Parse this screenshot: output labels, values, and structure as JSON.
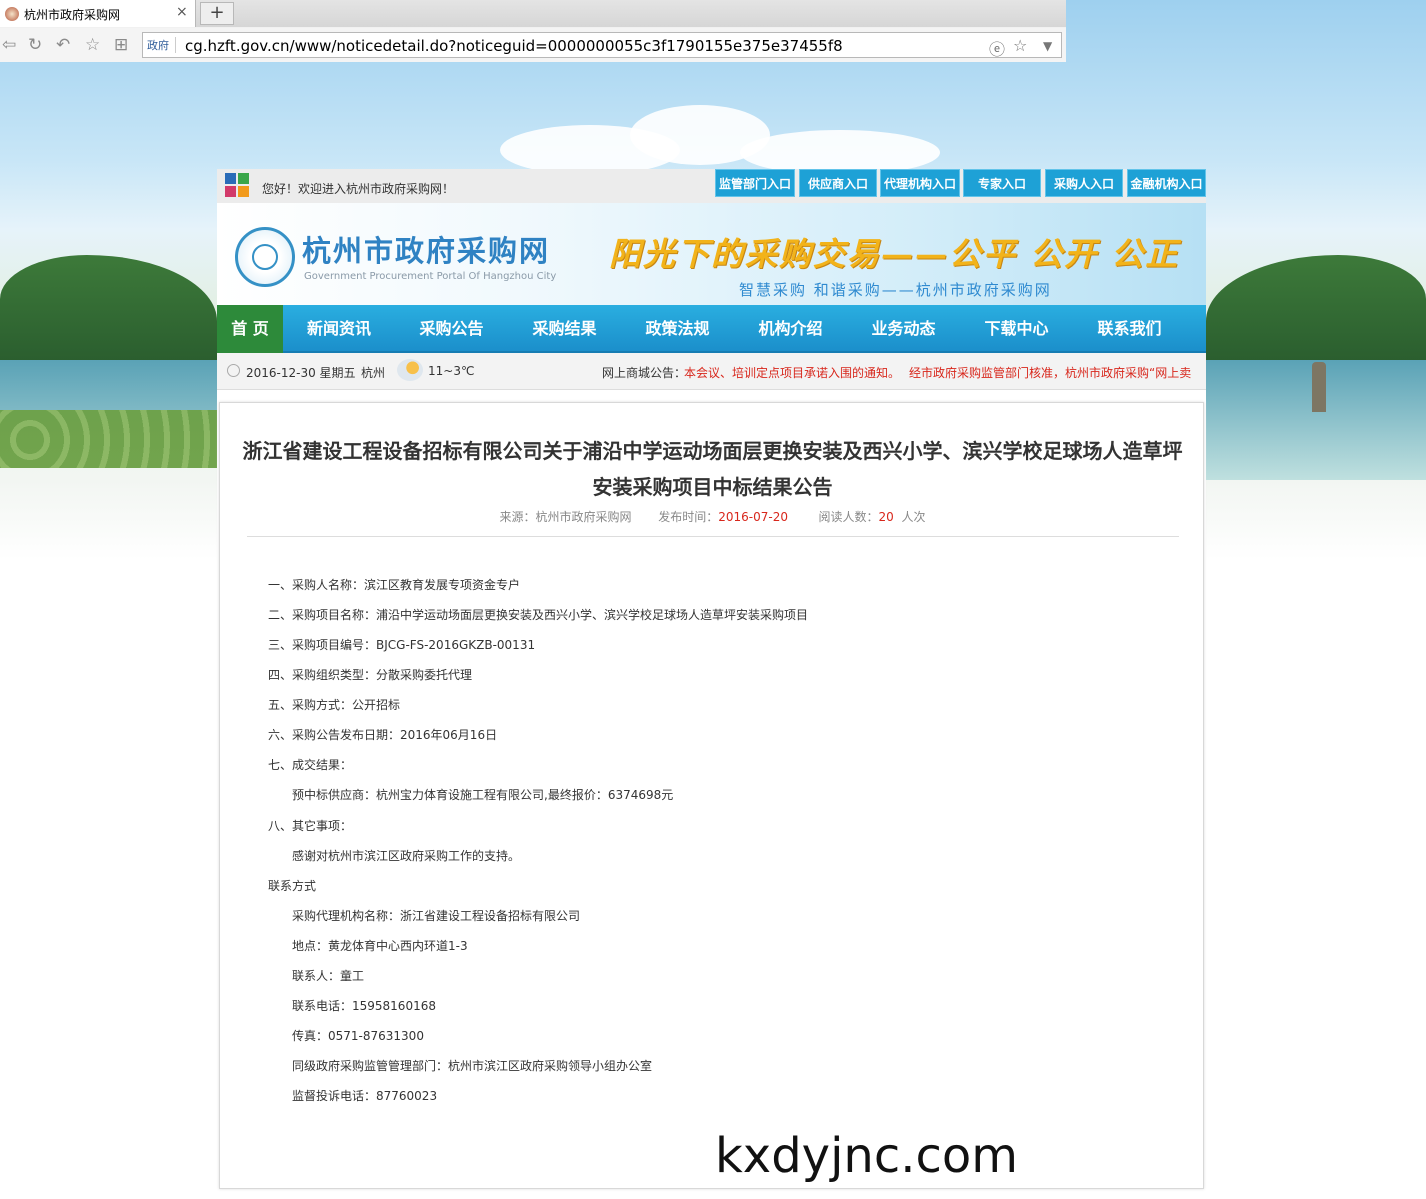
{
  "browser": {
    "tab_title": "杭州市政府采购网",
    "tab_close": "×",
    "new_tab": "+",
    "url_tag": "政府",
    "url": "cg.hzft.gov.cn/www/noticedetail.do?noticeguid=0000000055c3f1790155e375e37455f8"
  },
  "header": {
    "welcome": "您好！欢迎进入杭州市政府采购网！",
    "entries": [
      "监管部门入口",
      "供应商入口",
      "代理机构入口",
      "专家入口",
      "采购人入口",
      "金融机构入口"
    ],
    "site_name": "杭州市政府采购网",
    "site_name_en": "Government Procurement Portal Of Hangzhou City",
    "slogan": "阳光下的采购交易——公平  公开  公正",
    "sub_slogan": "智慧采购  和谐采购——杭州市政府采购网"
  },
  "nav": {
    "items": [
      "首 页",
      "新闻资讯",
      "采购公告",
      "采购结果",
      "政策法规",
      "机构介绍",
      "业务动态",
      "下载中心",
      "联系我们"
    ]
  },
  "infobar": {
    "date": "2016-12-30 星期五",
    "city": "杭州",
    "temp": "11~3℃",
    "notice_label": "网上商城公告：",
    "notice_1": "本会议、培训定点项目承诺入围的通知。",
    "notice_2": "经市政府采购监管部门核准，杭州市政府采购“网上卖"
  },
  "article": {
    "title_line1": "浙江省建设工程设备招标有限公司关于浦沿中学运动场面层更换安装及西兴小学、滨兴学校足球场人造草坪",
    "title_line2": "安装采购项目中标结果公告",
    "source_label": "来源：",
    "source": "杭州市政府采购网",
    "date_label": "发布时间：",
    "date": "2016-07-20",
    "reads_label": "阅读人数：",
    "reads": "20",
    "reads_unit": "人次",
    "lines": [
      "一、采购人名称：滨江区教育发展专项资金专户",
      "二、采购项目名称：浦沿中学运动场面层更换安装及西兴小学、滨兴学校足球场人造草坪安装采购项目",
      "三、采购项目编号：BJCG-FS-2016GKZB-00131",
      "四、采购组织类型：分散采购委托代理",
      "五、采购方式：公开招标",
      "六、采购公告发布日期：2016年06月16日",
      "七、成交结果：",
      "预中标供应商：杭州宝力体育设施工程有限公司,最终报价：6374698元",
      "八、其它事项：",
      "感谢对杭州市滨江区政府采购工作的支持。",
      "联系方式",
      "采购代理机构名称：浙江省建设工程设备招标有限公司",
      "地点：黄龙体育中心西内环道1-3",
      "联系人：童工",
      "联系电话：15958160168",
      "传真：0571-87631300",
      "同级政府采购监管管理部门：杭州市滨江区政府采购领导小组办公室",
      "监督投诉电话：87760023"
    ]
  },
  "watermark": "kxdyjnc.com",
  "colors": {
    "nav_blue": "#1ea1d6",
    "nav_active_green": "#2d8a3a",
    "notice_red": "#d8271c",
    "brand_blue": "#2f82c3",
    "slogan_gold": "#f2b31a"
  },
  "icons": [
    "back-icon",
    "refresh-icon",
    "undo-icon",
    "star-icon",
    "grid-icon",
    "ie-icon",
    "bookmark-star-icon",
    "dropdown-icon",
    "clock-icon",
    "weather-icon"
  ]
}
